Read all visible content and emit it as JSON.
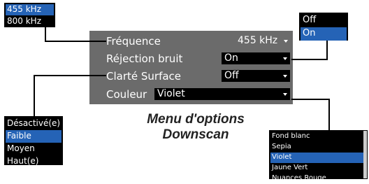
{
  "frequency_dropdown": {
    "options": [
      "455 kHz",
      "800 kHz"
    ],
    "selected_index": 0
  },
  "noise_dropdown": {
    "options": [
      "Off",
      "On"
    ],
    "selected_index": 1
  },
  "clarity_dropdown": {
    "options": [
      "Désactivé(e)",
      "Faible",
      "Moyen",
      "Haut(e)"
    ],
    "selected_index": 1
  },
  "color_dropdown": {
    "options": [
      "Fond blanc",
      "Sepia",
      "Violet",
      "Jaune Vert",
      "Nuances Rouge"
    ],
    "selected_index": 2
  },
  "menu": {
    "frequency": {
      "label": "Fréquence",
      "value": "455 kHz"
    },
    "noise_rejection": {
      "label": "Réjection bruit",
      "value": "On"
    },
    "surface_clarity": {
      "label": "Clarté Surface",
      "value": "Off"
    },
    "color": {
      "label": "Couleur",
      "value": "Violet"
    }
  },
  "caption": {
    "line1": "Menu d'options",
    "line2": "Downscan"
  },
  "colors": {
    "panel": "#6b6b6b",
    "selection": "#2563b6",
    "field": "#000000"
  }
}
